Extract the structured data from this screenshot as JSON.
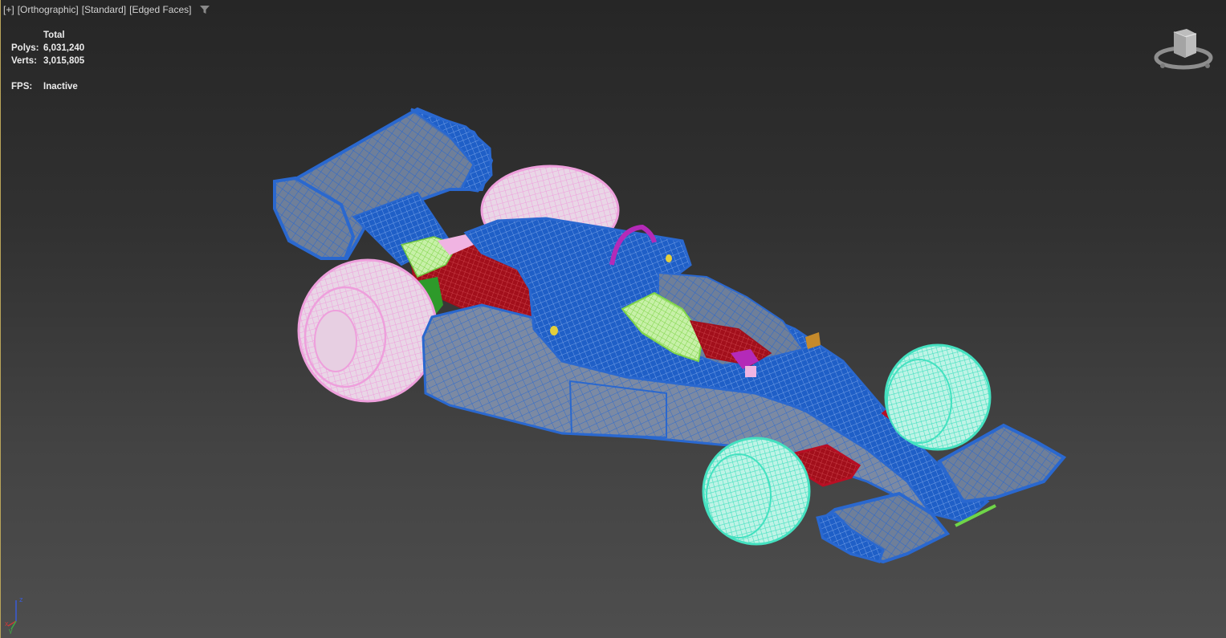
{
  "viewport": {
    "label_plus": "[+]",
    "label_view": "[Orthographic]",
    "label_shading": "[Standard]",
    "label_mode": "[Edged Faces]",
    "filter_icon": "funnel-icon"
  },
  "stats": {
    "header": "Total",
    "polys_label": "Polys:",
    "polys_value": "6,031,240",
    "verts_label": "Verts:",
    "verts_value": "3,015,805",
    "fps_label": "FPS:",
    "fps_value": "Inactive"
  },
  "axis": {
    "z": "z",
    "x": "x",
    "y": "y"
  },
  "colors": {
    "body": "#1f5fc7",
    "rear_tire": "#f0b4e2",
    "front_tire": "#48e3c3",
    "engine": "#a20f1b",
    "seat": "#9ae36a",
    "rollbar": "#b42ab8",
    "suspension": "#b80f24"
  }
}
